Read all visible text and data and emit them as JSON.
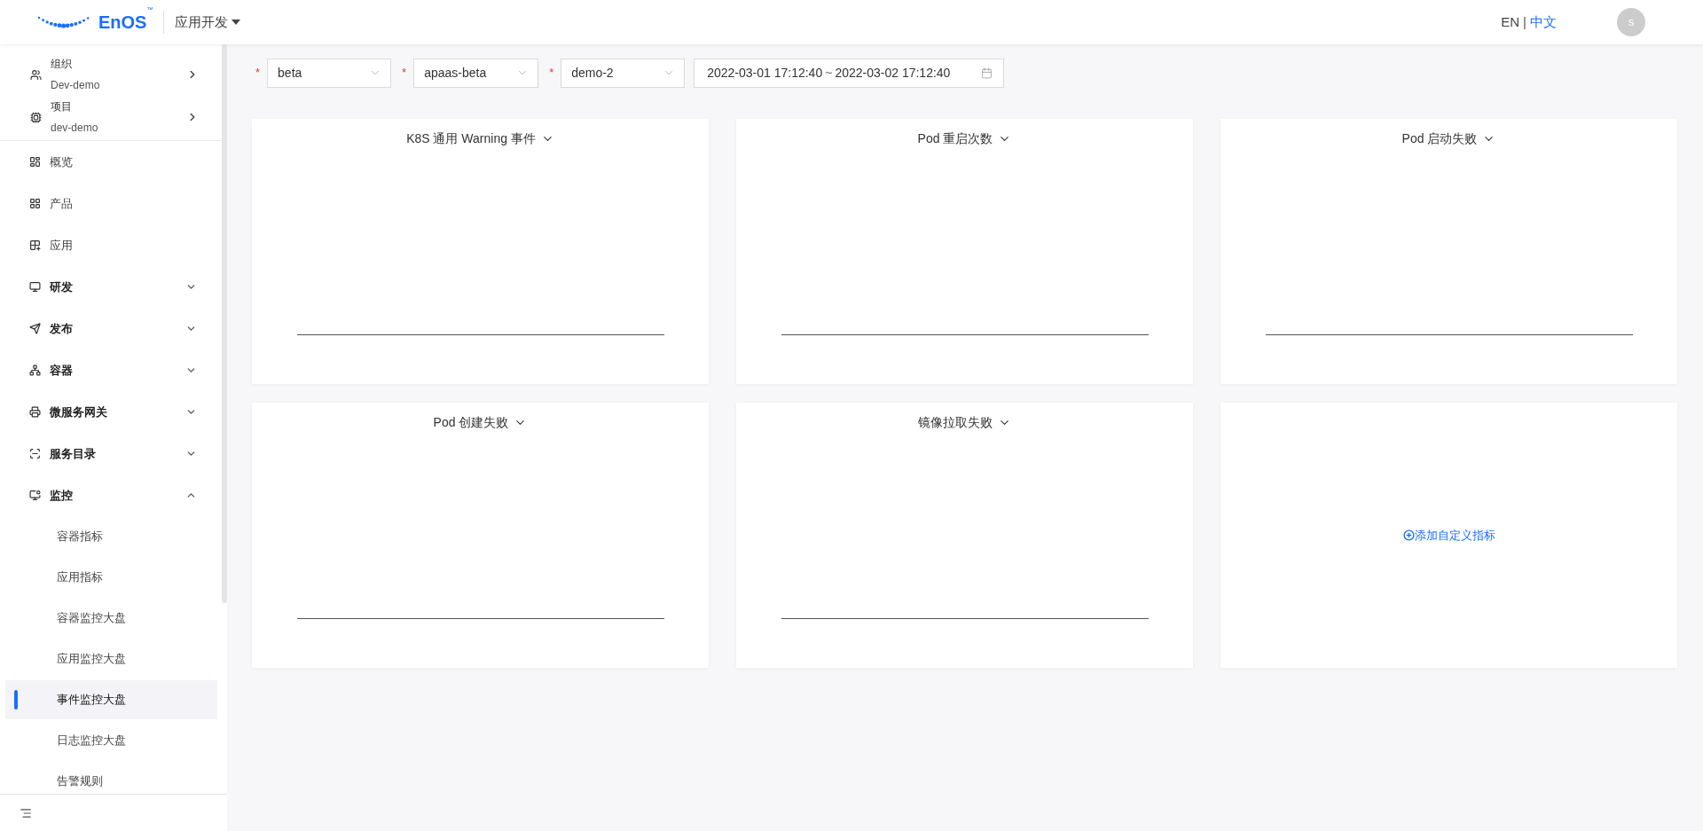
{
  "header": {
    "logo": "EnOS",
    "logo_mark": "™",
    "app_switcher": "应用开发",
    "languages": [
      {
        "label": "EN",
        "selected": false
      },
      {
        "label": "中文",
        "selected": true
      }
    ],
    "language_separator": "|",
    "avatar": "s"
  },
  "sidebar": {
    "context": [
      {
        "label": "组织",
        "value": "Dev-demo"
      },
      {
        "label": "项目",
        "value": "dev-demo"
      }
    ],
    "items": [
      {
        "kind": "link",
        "label": "概览"
      },
      {
        "kind": "link",
        "label": "产品"
      },
      {
        "kind": "link",
        "label": "应用"
      },
      {
        "kind": "group",
        "label": "研发",
        "expanded": false
      },
      {
        "kind": "group",
        "label": "发布",
        "expanded": false
      },
      {
        "kind": "group",
        "label": "容器",
        "expanded": false
      },
      {
        "kind": "group",
        "label": "微服务网关",
        "expanded": false
      },
      {
        "kind": "group",
        "label": "服务目录",
        "expanded": false
      },
      {
        "kind": "group",
        "label": "监控",
        "expanded": true,
        "children": [
          {
            "label": "容器指标",
            "selected": false
          },
          {
            "label": "应用指标",
            "selected": false
          },
          {
            "label": "容器监控大盘",
            "selected": false
          },
          {
            "label": "应用监控大盘",
            "selected": false
          },
          {
            "label": "事件监控大盘",
            "selected": true
          },
          {
            "label": "日志监控大盘",
            "selected": false
          },
          {
            "label": "告警规则",
            "selected": false
          }
        ]
      }
    ]
  },
  "filters": [
    {
      "mark": "*",
      "value": "beta"
    },
    {
      "mark": "*",
      "value": "apaas-beta"
    },
    {
      "mark": "*",
      "value": "demo-2"
    }
  ],
  "date_range": {
    "start": "2022-03-01 17:12:40",
    "separator": "~",
    "end": "2022-03-02 17:12:40"
  },
  "cards": [
    {
      "kind": "chart",
      "title": "K8S 通用 Warning 事件"
    },
    {
      "kind": "chart",
      "title": "Pod 重启次数"
    },
    {
      "kind": "chart",
      "title": "Pod 启动失败"
    },
    {
      "kind": "chart",
      "title": "Pod 创建失败"
    },
    {
      "kind": "chart",
      "title": "镜像拉取失败"
    },
    {
      "kind": "add",
      "label": "添加自定义指标"
    }
  ]
}
